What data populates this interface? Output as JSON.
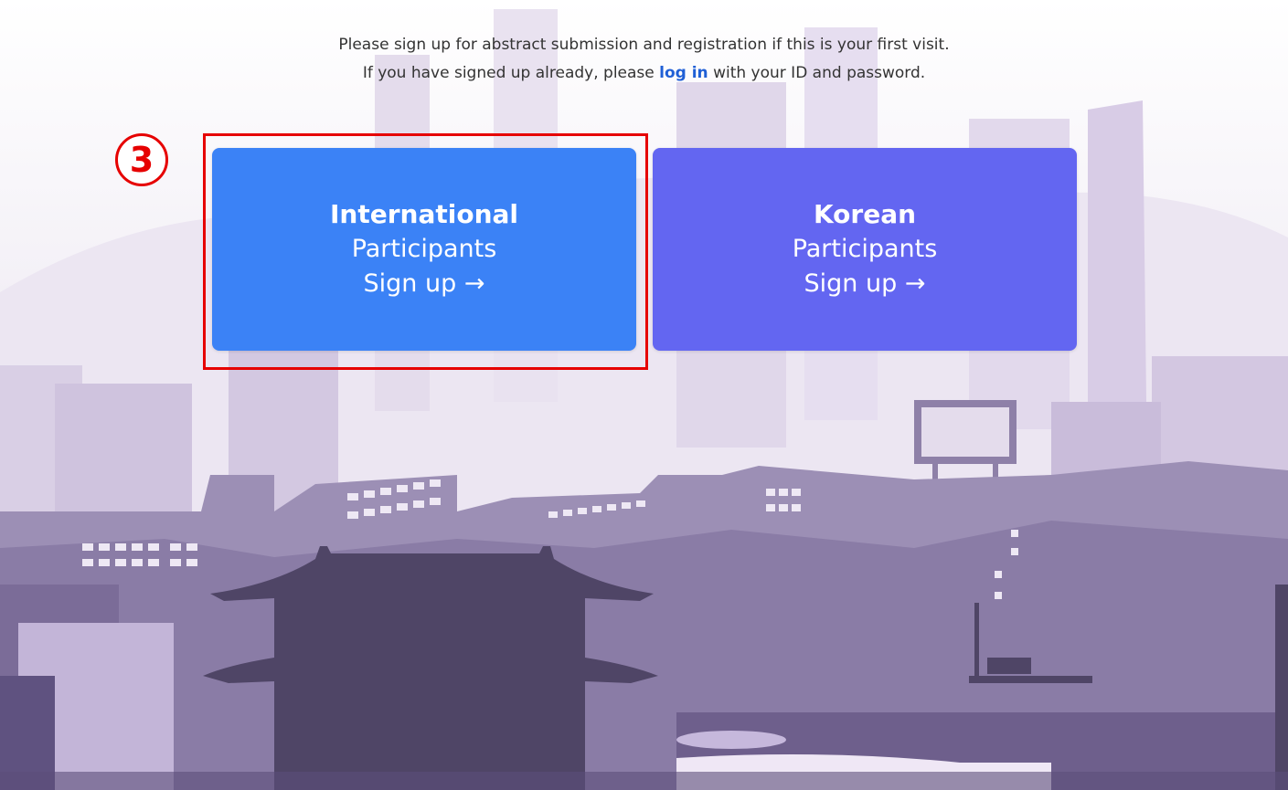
{
  "intro": {
    "line1": "Please sign up for abstract submission and registration if this is your first visit.",
    "line2_prefix": "If you have signed up already, please ",
    "login_link": "log in",
    "line2_suffix": " with your ID and password."
  },
  "cards": {
    "international": {
      "title": "International",
      "subtitle": "Participants",
      "action": "Sign up →"
    },
    "korean": {
      "title": "Korean",
      "subtitle": "Participants",
      "action": "Sign up →"
    }
  },
  "annotation": {
    "step_number": "3"
  },
  "colors": {
    "international_card": "#3b82f6",
    "korean_card": "#6366f1",
    "link": "#1f5fd6",
    "annotation": "#e60000"
  }
}
